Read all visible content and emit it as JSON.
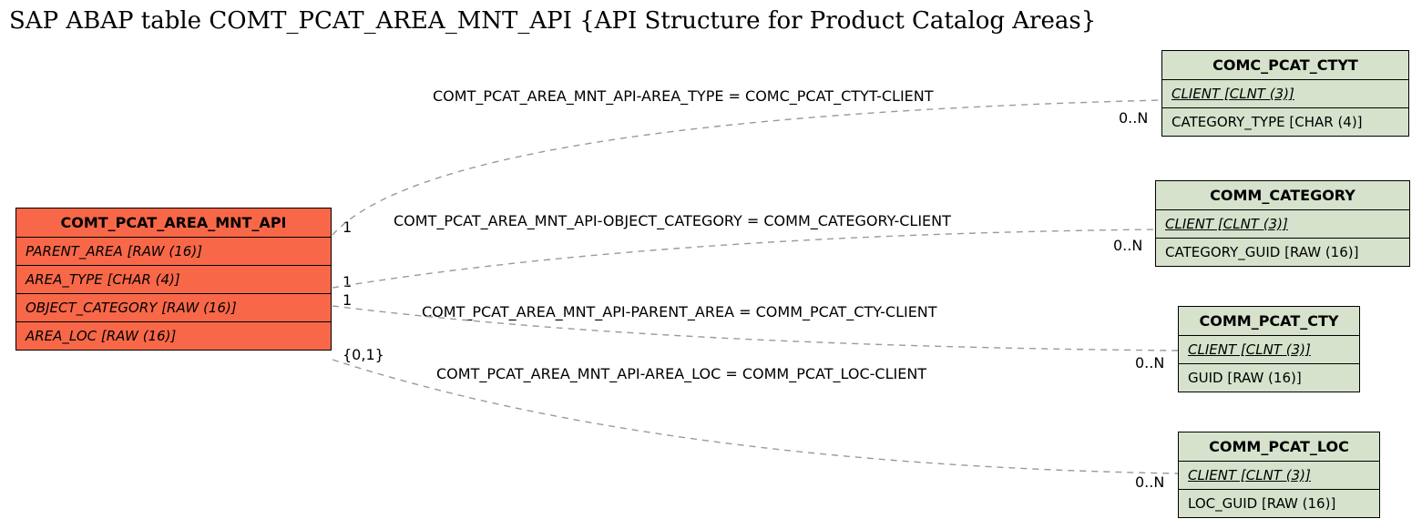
{
  "title": "SAP ABAP table COMT_PCAT_AREA_MNT_API {API Structure for Product Catalog Areas}",
  "main_table": {
    "name": "COMT_PCAT_AREA_MNT_API",
    "fields": {
      "f1": "PARENT_AREA [RAW (16)]",
      "f2": "AREA_TYPE [CHAR (4)]",
      "f3": "OBJECT_CATEGORY [RAW (16)]",
      "f4": "AREA_LOC [RAW (16)]"
    }
  },
  "rel_tables": {
    "t1": {
      "name": "COMC_PCAT_CTYT",
      "pk": "CLIENT [CLNT (3)]",
      "f1": "CATEGORY_TYPE [CHAR (4)]"
    },
    "t2": {
      "name": "COMM_CATEGORY",
      "pk": "CLIENT [CLNT (3)]",
      "f1": "CATEGORY_GUID [RAW (16)]"
    },
    "t3": {
      "name": "COMM_PCAT_CTY",
      "pk": "CLIENT [CLNT (3)]",
      "f1": "GUID [RAW (16)]"
    },
    "t4": {
      "name": "COMM_PCAT_LOC",
      "pk": "CLIENT [CLNT (3)]",
      "f1": "LOC_GUID [RAW (16)]"
    }
  },
  "rel_labels": {
    "r1": "COMT_PCAT_AREA_MNT_API-AREA_TYPE = COMC_PCAT_CTYT-CLIENT",
    "r2": "COMT_PCAT_AREA_MNT_API-OBJECT_CATEGORY = COMM_CATEGORY-CLIENT",
    "r3": "COMT_PCAT_AREA_MNT_API-PARENT_AREA = COMM_PCAT_CTY-CLIENT",
    "r4": "COMT_PCAT_AREA_MNT_API-AREA_LOC = COMM_PCAT_LOC-CLIENT"
  },
  "card": {
    "left1": "1",
    "left2": "1",
    "left3": "1",
    "left4": "{0,1}",
    "right1": "0..N",
    "right2": "0..N",
    "right3": "0..N",
    "right4": "0..N"
  }
}
